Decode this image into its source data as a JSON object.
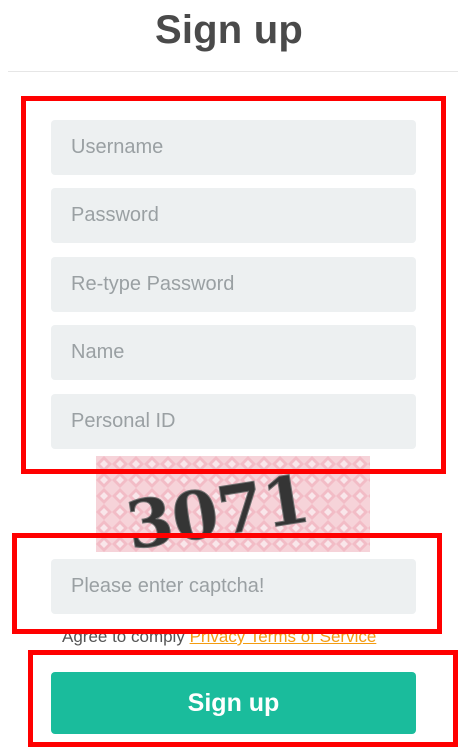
{
  "header": {
    "title": "Sign up"
  },
  "form": {
    "fields": [
      {
        "placeholder": "Username",
        "value": ""
      },
      {
        "placeholder": "Password",
        "value": ""
      },
      {
        "placeholder": "Re-type Password",
        "value": ""
      },
      {
        "placeholder": "Name",
        "value": ""
      },
      {
        "placeholder": "Personal ID",
        "value": ""
      }
    ],
    "captcha_text": "3071",
    "captcha_input": {
      "placeholder": "Please enter captcha!",
      "value": ""
    },
    "agreement": {
      "prefix": "Agree to comply",
      "link_text": "Privacy Terms of Service"
    },
    "submit_label": "Sign up"
  },
  "colors": {
    "accent": "#1abc9c",
    "link": "#f39c12",
    "field_bg": "#edf0f1",
    "highlight": "#ff0000"
  }
}
